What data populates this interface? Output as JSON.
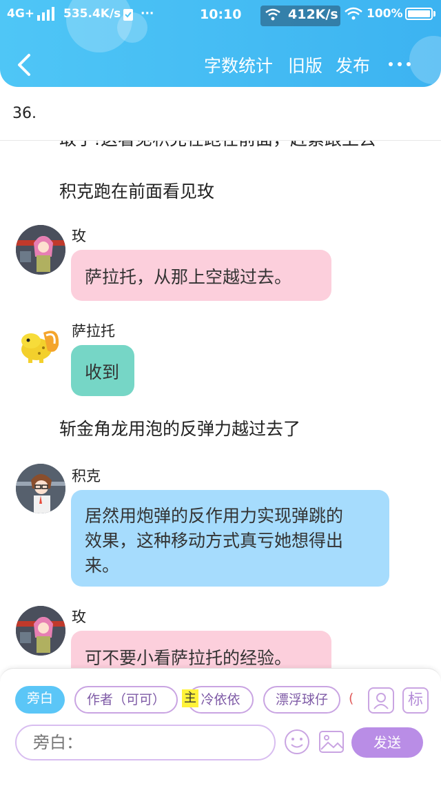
{
  "status_bar": {
    "network": "4G+",
    "speed": "535.4K/s",
    "time": "10:10",
    "overlay_speed": "412K/s",
    "battery": "100%"
  },
  "header": {
    "actions": [
      "字数统计",
      "旧版",
      "发布"
    ],
    "back_icon": "chevron-left-icon",
    "more_icon": "more-dots-icon"
  },
  "chapter": {
    "title": "36."
  },
  "feed": {
    "cut_line": "敢于!这看见积克在跑在前面，赶紧跟上去",
    "narration_1": "积克跑在前面看见玫",
    "msg_1": {
      "name": "玫",
      "text": "萨拉托，从那上空越过去。"
    },
    "msg_2": {
      "name": "萨拉托",
      "text": "收到"
    },
    "narration_2": "斩金角龙用泡的反弹力越过去了",
    "msg_3": {
      "name": "积克",
      "lines": [
        "居然用炮弹的反作用力实现弹跳的",
        "效果，这种移动方式真亏她想得出",
        "来。"
      ]
    },
    "msg_4": {
      "name": "玫",
      "text": "可不要小看萨拉托的经验。"
    }
  },
  "composer": {
    "roles": [
      {
        "label": "旁白"
      },
      {
        "label": "作者（可可）"
      },
      {
        "label": "冷依依",
        "mark": "主"
      },
      {
        "label": "漂浮球仔"
      },
      {
        "label": "("
      }
    ],
    "input_placeholder": "旁白：",
    "send_label": "发送",
    "mark_label": "主",
    "icons": [
      "add-role-icon",
      "tag-icon",
      "emoji-icon",
      "image-icon"
    ],
    "tag_label": "标"
  },
  "colors": {
    "header": "#4fc6f6",
    "pink_bubble": "#fccfdc",
    "teal_bubble": "#76d6c6",
    "blue_bubble": "#a6dcfd",
    "accent_purple": "#b98de6"
  }
}
